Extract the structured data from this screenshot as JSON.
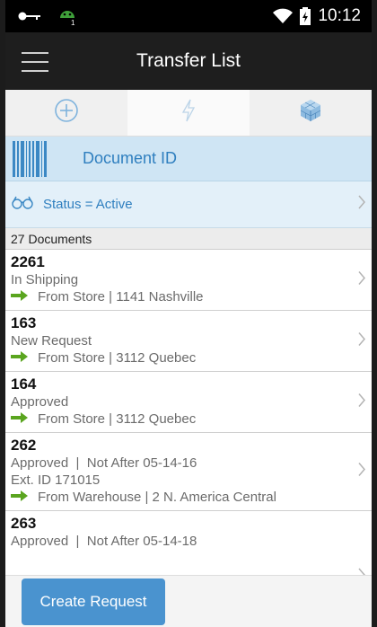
{
  "status_bar": {
    "icons": [
      "key-icon",
      "android-notification-icon",
      "wifi-icon",
      "battery-icon"
    ],
    "time": "10:12"
  },
  "app_bar": {
    "title": "Transfer List",
    "menu_icon": "hamburger-menu-icon"
  },
  "tabs": [
    {
      "icon": "plus-circle-icon",
      "active": false
    },
    {
      "icon": "lightning-icon",
      "active": true
    },
    {
      "icon": "cube-icon",
      "active": false
    }
  ],
  "document_field": {
    "icon": "barcode-icon",
    "label": "Document ID"
  },
  "filter": {
    "icon": "glasses-icon",
    "label": "Status = Active"
  },
  "list": {
    "count_label": "27 Documents",
    "items": [
      {
        "id": "2261",
        "lines": [
          "In Shipping"
        ],
        "from": "From Store | 1141 Nashville"
      },
      {
        "id": "163",
        "lines": [
          "New Request"
        ],
        "from": "From Store | 3112 Quebec"
      },
      {
        "id": "164",
        "lines": [
          "Approved"
        ],
        "from": "From Store | 3112 Quebec"
      },
      {
        "id": "262",
        "lines": [
          "Approved  |  Not After 05-14-16",
          "Ext. ID 171015"
        ],
        "from": "From Warehouse | 2 N. America Central"
      },
      {
        "id": "263",
        "lines": [
          "Approved  |  Not After 05-14-18"
        ],
        "from": ""
      }
    ]
  },
  "actions": {
    "create_label": "Create Request"
  },
  "colors": {
    "accent_blue": "#2f7fbf",
    "button_blue": "#4a93cf",
    "arrow_green": "#5aa51f",
    "doc_row_bg": "#cfe5f4",
    "filter_row_bg": "#e3f0f9"
  }
}
